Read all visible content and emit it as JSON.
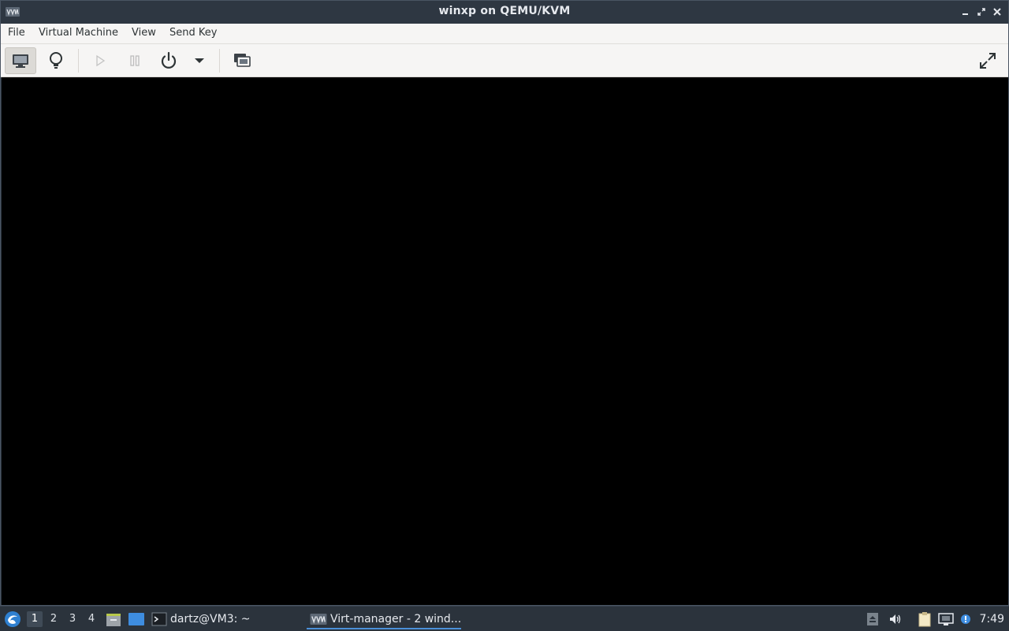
{
  "window": {
    "title": "winxp on QEMU/KVM"
  },
  "menubar": {
    "items": [
      "File",
      "Virtual Machine",
      "View",
      "Send Key"
    ]
  },
  "toolbar": {
    "icons": [
      "console-icon",
      "details-icon",
      "run-icon",
      "pause-icon",
      "power-icon",
      "dropdown-icon",
      "snapshots-icon",
      "fullscreen-icon"
    ]
  },
  "taskbar": {
    "workspaces": [
      "1",
      "2",
      "3",
      "4"
    ],
    "active_workspace": "1",
    "tasks": [
      {
        "label": "dartz@VM3: ~",
        "icon": "terminal-icon"
      },
      {
        "label": "Virt-manager - 2 wind...",
        "icon": "virt-manager-icon"
      }
    ],
    "clock": "7:49"
  },
  "colors": {
    "titlebar": "#2e3742",
    "toolbar": "#f6f5f4",
    "display": "#000000",
    "taskbar": "#2b333c",
    "accent": "#4a90d9"
  }
}
